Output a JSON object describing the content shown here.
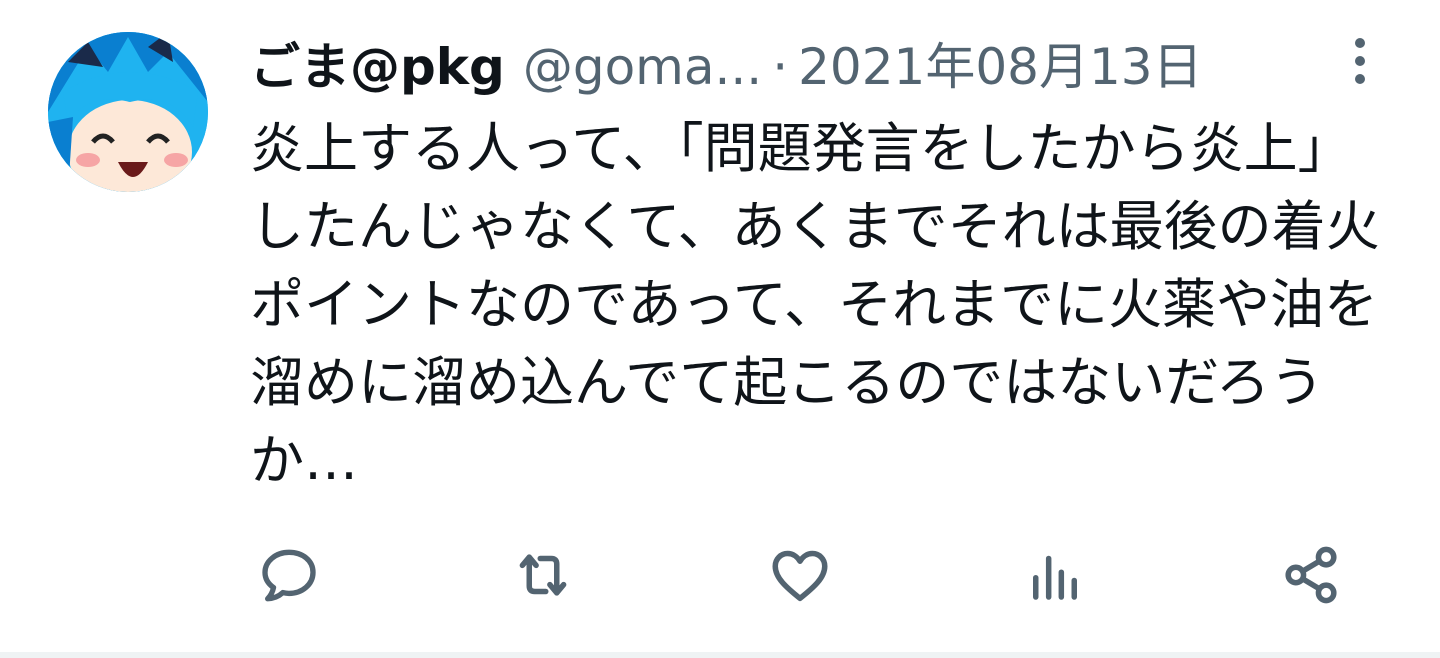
{
  "tweet": {
    "display_name": "ごま@pkg",
    "handle": "@goma...",
    "separator": "·",
    "date": "2021年08月13日",
    "text": "炎上する人って、「問題発言をしたから炎上」したんじゃなくて、あくまでそれは最後の着火ポイントなのであって、それまでに火薬や油を溜めに溜め込んでて起こるのではないだろうか…"
  },
  "icons": {
    "avatar": "anime-character-avatar",
    "more": "more-vertical-icon",
    "reply": "reply-icon",
    "retweet": "retweet-icon",
    "like": "like-heart-icon",
    "views": "analytics-bars-icon",
    "share": "share-icon"
  },
  "colors": {
    "text_primary": "#0f1419",
    "text_secondary": "#536471",
    "icon": "#536471",
    "divider": "#eff3f4",
    "avatar_accent": "#1da1f2"
  }
}
